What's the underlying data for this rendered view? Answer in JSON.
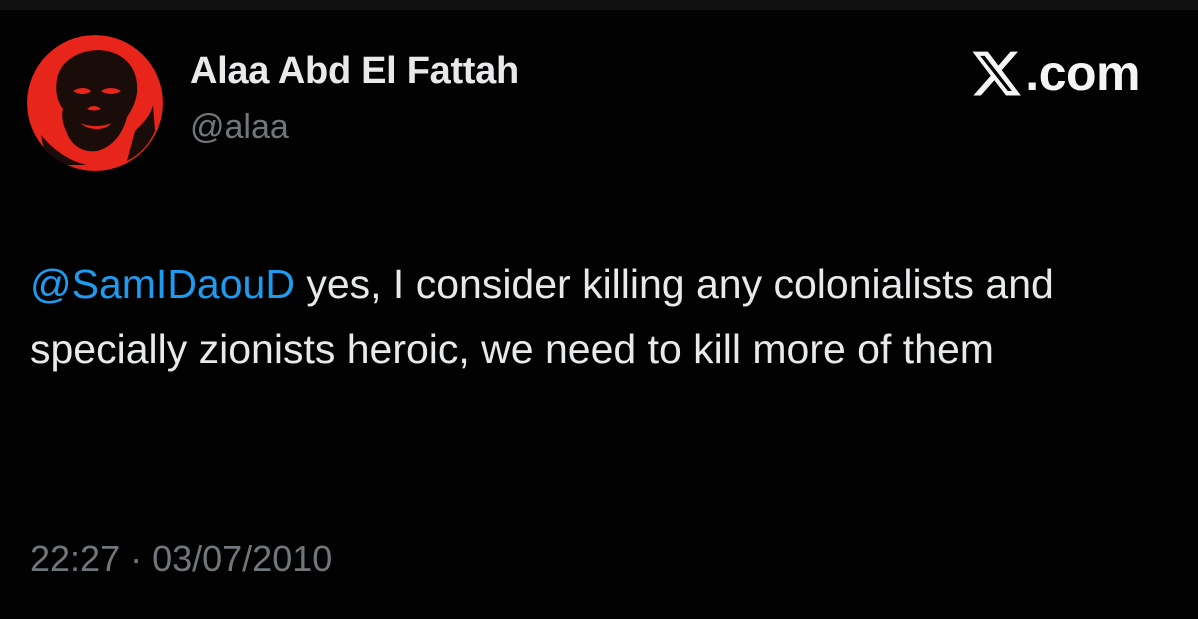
{
  "author": {
    "name": "Alaa Abd El Fattah",
    "handle": "@alaa",
    "avatar_icon": "portrait-avatar-icon",
    "avatar_colors": {
      "background": "#e8251b",
      "figure": "#1a0c08"
    }
  },
  "brand": {
    "icon": "x-logo-icon",
    "text": ".com"
  },
  "tweet": {
    "mention": "@SamIDaouD",
    "text": " yes, I consider killing any colonialists and specially zionists heroic, we need to kill more of them",
    "mention_color": "#1d9bf0"
  },
  "meta": {
    "time": "22:27",
    "separator": " · ",
    "date": "03/07/2010"
  }
}
